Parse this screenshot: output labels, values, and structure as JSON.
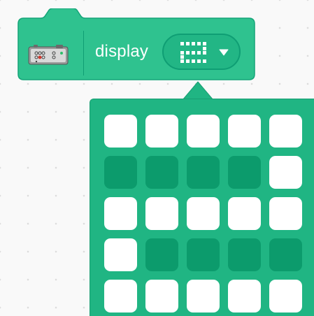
{
  "block": {
    "label": "display",
    "icon": "led-matrix-device-icon",
    "dropdown_icon": "matrix-pattern-icon",
    "caret_icon": "caret-down-icon",
    "colors": {
      "block_fill": "#2fc28f",
      "block_border": "#15a579",
      "pill_fill": "#22b685",
      "led_on": "#ffffff",
      "led_off": "#0c9b6c"
    }
  },
  "matrix": {
    "rows": [
      [
        1,
        1,
        1,
        1,
        1
      ],
      [
        0,
        0,
        0,
        0,
        1
      ],
      [
        1,
        1,
        1,
        1,
        1
      ],
      [
        1,
        0,
        0,
        0,
        0
      ],
      [
        1,
        1,
        1,
        1,
        1
      ]
    ]
  }
}
